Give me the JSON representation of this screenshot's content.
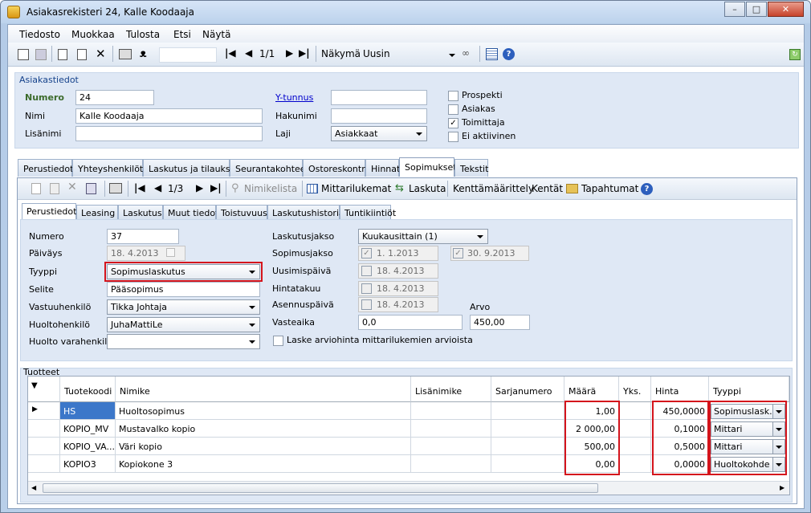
{
  "window": {
    "title": "Asiakasrekisteri 24, Kalle Koodaaja"
  },
  "menu": [
    "Tiedosto",
    "Muokkaa",
    "Tulosta",
    "Etsi",
    "Näytä"
  ],
  "toolbar": {
    "page": "1/1",
    "view_label": "Näkymä",
    "view_value": "Uusin"
  },
  "customer": {
    "group_title": "Asiakastiedot",
    "numero_label": "Numero",
    "numero": "24",
    "nimi_label": "Nimi",
    "nimi": "Kalle Koodaaja",
    "lisanimi_label": "Lisänimi",
    "lisanimi": "",
    "ytunnus_label": "Y-tunnus",
    "ytunnus": "",
    "hakunimi_label": "Hakunimi",
    "hakunimi": "",
    "laji_label": "Laji",
    "laji": "Asiakkaat",
    "checks": [
      {
        "label": "Prospekti",
        "checked": false
      },
      {
        "label": "Asiakas",
        "checked": false
      },
      {
        "label": "Toimittaja",
        "checked": true
      },
      {
        "label": "Ei aktiivinen",
        "checked": false
      }
    ]
  },
  "tabs": [
    "Perustiedot",
    "Yhteyshenkilöt",
    "Laskutus ja tilaukset",
    "Seurantakohteet",
    "Ostoreskontra",
    "Hinnat",
    "Sopimukset",
    "Tekstit"
  ],
  "active_tab": "Sopimukset",
  "contract_toolbar": {
    "page": "1/3",
    "nimikelista": "Nimikelista",
    "mittarilukemat": "Mittarilukemat",
    "laskuta": "Laskuta",
    "kenttamaarittely": "Kenttämäärittely",
    "kentat": "Kentät",
    "tapahtumat": "Tapahtumat"
  },
  "subtabs": [
    "Perustiedot",
    "Leasing",
    "Laskutus",
    "Muut tiedot",
    "Toistuvuus",
    "Laskutushistoria",
    "Tuntikiintiöt"
  ],
  "contract": {
    "numero_label": "Numero",
    "numero": "37",
    "paivays_label": "Päiväys",
    "paivays": "18. 4.2013",
    "tyyppi_label": "Tyyppi",
    "tyyppi": "Sopimuslaskutus",
    "selite_label": "Selite",
    "selite": "Pääsopimus",
    "vastuuhenkilo_label": "Vastuuhenkilö",
    "vastuuhenkilo": "Tikka Johtaja",
    "huoltohenkilo_label": "Huoltohenkilö",
    "huoltohenkilo": "JuhaMattiLe",
    "varahenkilo_label": "Huolto varahenkilö",
    "varahenkilo": "",
    "laskutusjakso_label": "Laskutusjakso",
    "laskutusjakso": "Kuukausittain (1)",
    "sopimusjakso_label": "Sopimusjakso",
    "sopimusjakso_start": "1. 1.2013",
    "sopimusjakso_end": "30. 9.2013",
    "uusimispaiva_label": "Uusimispäivä",
    "uusimispaiva": "18. 4.2013",
    "hintatakuu_label": "Hintatakuu",
    "hintatakuu": "18. 4.2013",
    "asennuspaiva_label": "Asennuspäivä",
    "asennuspaiva": "18. 4.2013",
    "vasteaika_label": "Vasteaika",
    "vasteaika": "0,0",
    "arvo_label": "Arvo",
    "arvo": "450,00",
    "laske_label": "Laske arviohinta mittarilukemien arvioista"
  },
  "products": {
    "group_title": "Tuotteet",
    "columns": [
      "Tuotekoodi",
      "Nimike",
      "Lisänimike",
      "Sarjanumero",
      "Määrä",
      "Yks.",
      "Hinta",
      "Tyyppi"
    ],
    "rows": [
      {
        "code": "HS",
        "name": "Huoltosopimus",
        "extra": "",
        "serial": "",
        "qty": "1,00",
        "unit": "",
        "price": "450,0000",
        "type": "Sopimuslask..."
      },
      {
        "code": "KOPIO_MV",
        "name": "Mustavalko kopio",
        "extra": "",
        "serial": "",
        "qty": "2 000,00",
        "unit": "",
        "price": "0,1000",
        "type": "Mittari"
      },
      {
        "code": "KOPIO_VA...",
        "name": "Väri kopio",
        "extra": "",
        "serial": "",
        "qty": "500,00",
        "unit": "",
        "price": "0,5000",
        "type": "Mittari"
      },
      {
        "code": "KOPIO3",
        "name": "Kopiokone 3",
        "extra": "",
        "serial": "",
        "qty": "0,00",
        "unit": "",
        "price": "0,0000",
        "type": "Huoltokohde"
      }
    ]
  },
  "colors": {
    "highlight": "#d4141c",
    "selected": "#3c77c9"
  }
}
